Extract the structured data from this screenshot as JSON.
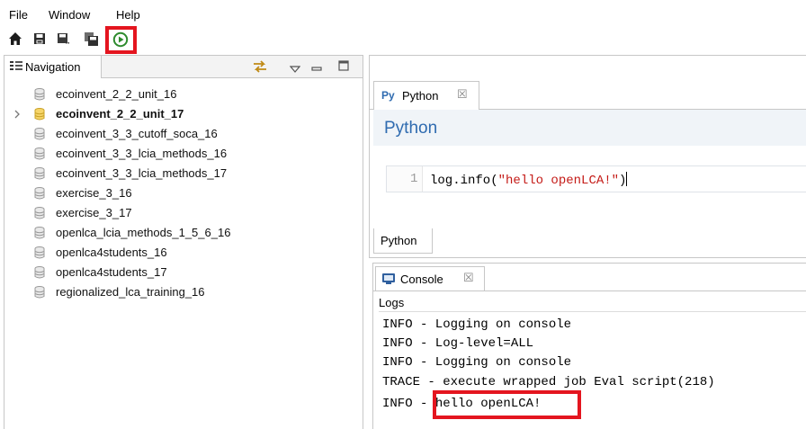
{
  "menu": {
    "file": "File",
    "window": "Window",
    "help": "Help"
  },
  "toolbar": {
    "icons": [
      "home-icon",
      "save-icon",
      "save-as-icon",
      "save-all-icon",
      "run-icon"
    ],
    "highlight_color": "#e4151f",
    "run_color": "#2e8b2e"
  },
  "navigation": {
    "tab_label": "Navigation",
    "items": [
      {
        "label": "ecoinvent_2_2_unit_16",
        "active": false
      },
      {
        "label": "ecoinvent_2_2_unit_17",
        "active": true
      },
      {
        "label": "ecoinvent_3_3_cutoff_soca_16",
        "active": false
      },
      {
        "label": "ecoinvent_3_3_lcia_methods_16",
        "active": false
      },
      {
        "label": "ecoinvent_3_3_lcia_methods_17",
        "active": false
      },
      {
        "label": "exercise_3_16",
        "active": false
      },
      {
        "label": "exercise_3_17",
        "active": false
      },
      {
        "label": "openlca_lcia_methods_1_5_6_16",
        "active": false
      },
      {
        "label": "openlca4students_16",
        "active": false
      },
      {
        "label": "openlca4students_17",
        "active": false
      },
      {
        "label": "regionalized_lca_training_16",
        "active": false
      }
    ]
  },
  "editor": {
    "tab_icon": "Py",
    "tab_label": "Python",
    "close_glyph": "☒",
    "title": "Python",
    "line_number": "1",
    "code_prefix": "log.info(",
    "code_string": "\"hello openLCA!\"",
    "code_suffix": ")",
    "bottom_tab": "Python",
    "accent": "#2f6bb0",
    "string_color": "#c41a16"
  },
  "console": {
    "tab_label": "Console",
    "close_glyph": "☒",
    "logs_label": "Logs",
    "lines": [
      "INFO - Logging on console",
      "INFO - Log-level=ALL",
      "INFO - Logging on console",
      "TRACE - execute wrapped job Eval script(218)"
    ],
    "last_line_prefix": "INFO - ",
    "last_line_highlight": "hello openLCA!"
  }
}
